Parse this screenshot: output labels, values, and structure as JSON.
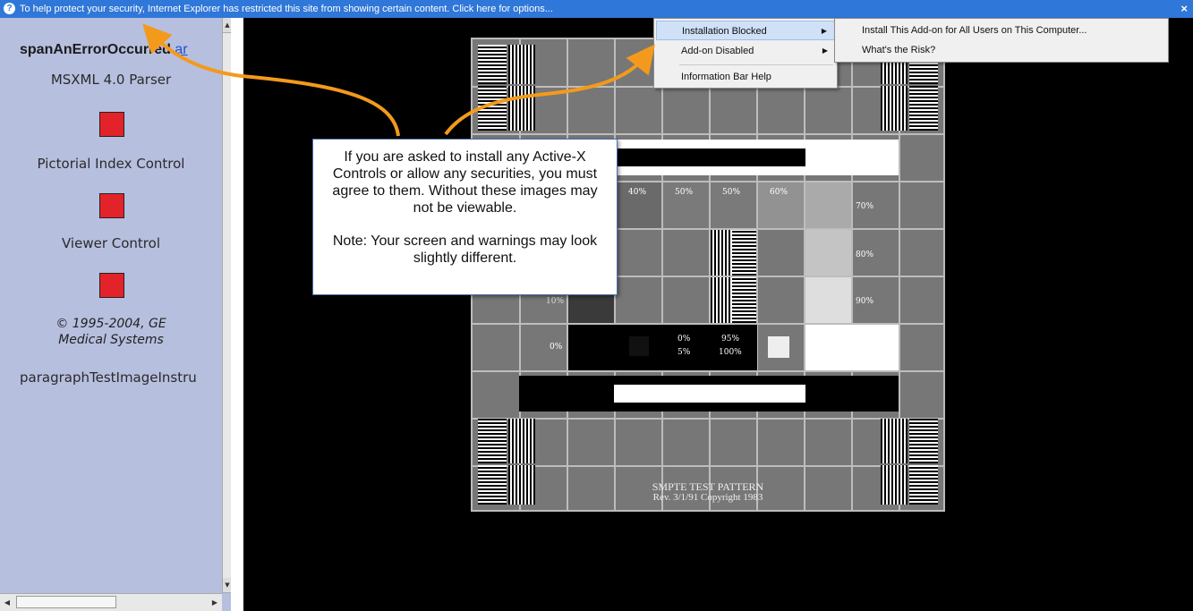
{
  "infobar": {
    "icon": "help-question-icon",
    "message": "To help protect your security, Internet Explorer has restricted this site from showing certain content. Click here for options...",
    "close_glyph": "×"
  },
  "leftpane": {
    "error_title": "spanAnErrorOccurred",
    "error_link": "ar",
    "controls": [
      {
        "label": "MSXML 4.0 Parser"
      },
      {
        "label": "Pictorial Index Control"
      },
      {
        "label": "Viewer Control"
      }
    ],
    "copyright_line1": "© 1995-2004, GE",
    "copyright_line2": "Medical Systems",
    "instructions": "paragraphTestImageInstru",
    "status_color": "#e3232a"
  },
  "pattern": {
    "labels_top": [
      "40%",
      "50%",
      "50%",
      "60%"
    ],
    "label_70": "70%",
    "label_80": "80%",
    "label_90": "90%",
    "label_10": "10%",
    "label_0": "0%",
    "mid_a": "0%",
    "mid_b": "5%",
    "mid_c": "95%",
    "mid_d": "100%",
    "label_100": "100%",
    "title": "SMPTE TEST PATTERN",
    "subtitle": "Rev. 3/1/91 Copyright 1983"
  },
  "callout": {
    "text": "If you are asked to install any Active-X Controls or allow any securities, you must agree to them.  Without these images may not be viewable.",
    "note": "Note: Your screen and warnings may look slightly different."
  },
  "menu": {
    "items": [
      {
        "label": "Installation Blocked",
        "has_submenu": true
      },
      {
        "label": "Add-on Disabled",
        "has_submenu": true
      },
      {
        "label": "Information Bar Help",
        "has_submenu": false
      }
    ],
    "submenu": [
      {
        "label": "Install This Add-on for All Users on This Computer..."
      },
      {
        "label": "What's the Risk?"
      }
    ]
  },
  "colors": {
    "infobar": "#2f77d8",
    "leftpane": "#b7bfdf",
    "arrow": "#f39a1c"
  }
}
